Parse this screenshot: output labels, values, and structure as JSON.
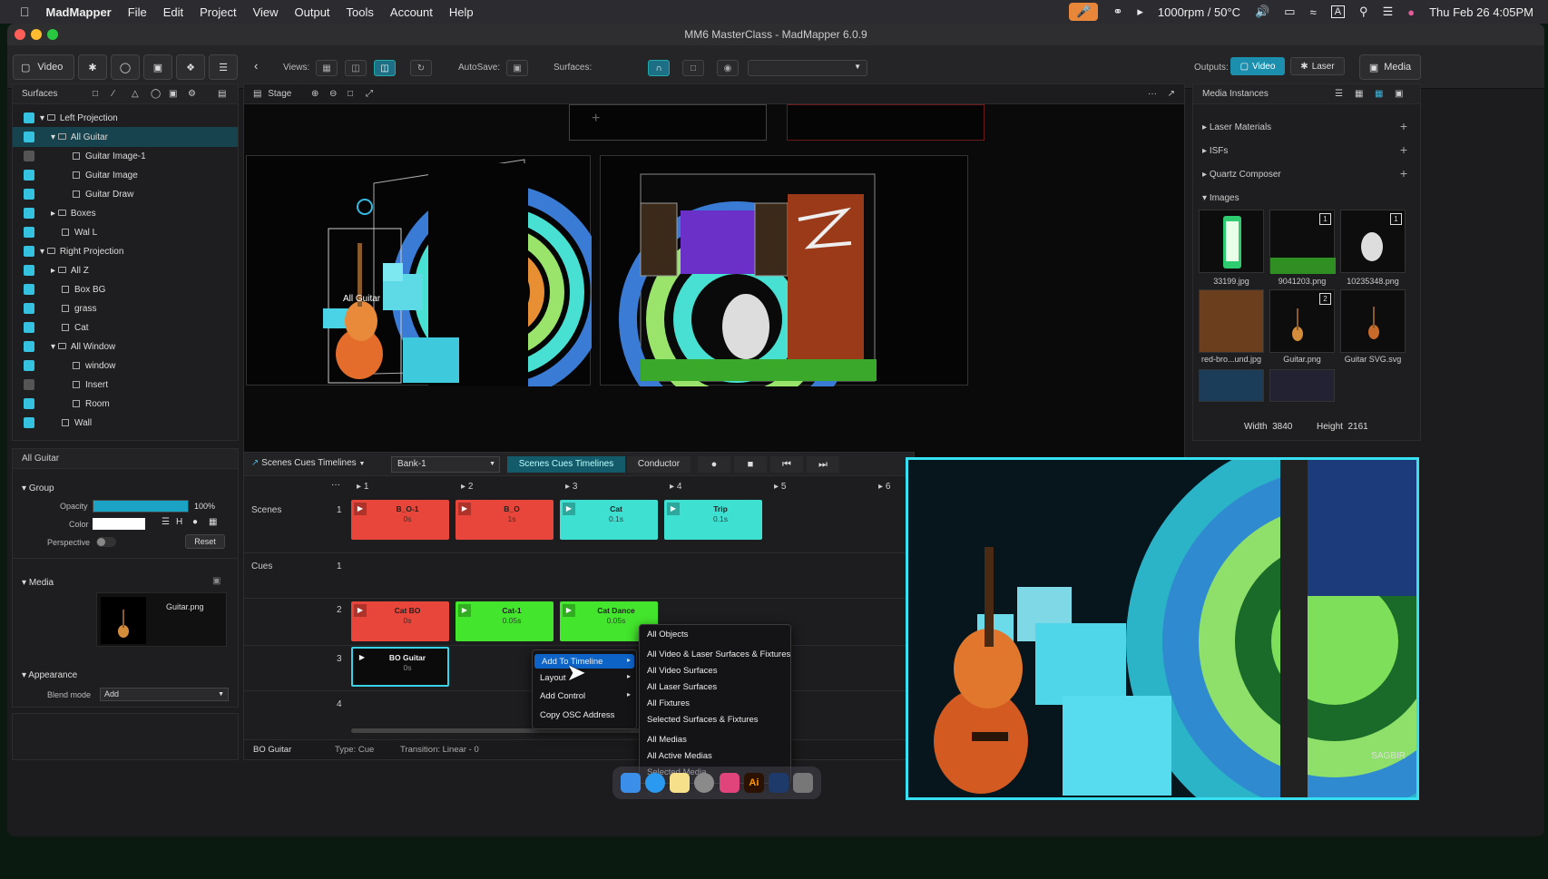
{
  "menubar": {
    "app": "MadMapper",
    "items": [
      "File",
      "Edit",
      "Project",
      "View",
      "Output",
      "Tools",
      "Account",
      "Help"
    ],
    "status": "1000rpm / 50°C",
    "clock": "Thu Feb 26  4:05PM"
  },
  "window": {
    "title": "MM6 MasterClass - MadMapper 6.0.9"
  },
  "toolbar": {
    "video_label": "Video",
    "views_label": "Views:",
    "autosave_label": "AutoSave:",
    "surfaces_label": "Surfaces:",
    "outputs_label": "Outputs:",
    "output_video": "Video",
    "output_laser": "Laser",
    "media_label": "Media"
  },
  "surfaces": {
    "title": "Surfaces",
    "items": [
      {
        "label": "Left Projection",
        "checked": true
      },
      {
        "label": "All Guitar",
        "checked": true
      },
      {
        "label": "Guitar Image-1",
        "checked": false
      },
      {
        "label": "Guitar Image",
        "checked": true
      },
      {
        "label": "Guitar Draw",
        "checked": true
      },
      {
        "label": "Boxes",
        "checked": true
      },
      {
        "label": "Wal L",
        "checked": true
      },
      {
        "label": "Right Projection",
        "checked": true
      },
      {
        "label": "All Z",
        "checked": true
      },
      {
        "label": "Box BG",
        "checked": true
      },
      {
        "label": "grass",
        "checked": true
      },
      {
        "label": "Cat",
        "checked": true
      },
      {
        "label": "All Window",
        "checked": true
      },
      {
        "label": "window",
        "checked": true
      },
      {
        "label": "Insert",
        "checked": false
      },
      {
        "label": "Room",
        "checked": true
      },
      {
        "label": "Wall",
        "checked": true
      }
    ]
  },
  "inspector": {
    "title": "All Guitar",
    "group_label": "Group",
    "opacity_label": "Opacity",
    "opacity_value": "100%",
    "opacity": 1.0,
    "color_label": "Color",
    "perspective_label": "Perspective",
    "reset_label": "Reset",
    "media_label": "Media",
    "media_file": "Guitar.png",
    "appearance_label": "Appearance",
    "blend_label": "Blend mode",
    "blend_value": "Add"
  },
  "stage": {
    "tab": "Stage",
    "overlay_label": "All Guitar"
  },
  "media_instances": {
    "title": "Media Instances",
    "sections": [
      "Laser Materials",
      "ISFs",
      "Quartz Composer",
      "Images"
    ],
    "images": [
      {
        "name": "33199.jpg",
        "badge": ""
      },
      {
        "name": "9041203.png",
        "badge": "1"
      },
      {
        "name": "10235348.png",
        "badge": "1"
      },
      {
        "name": "red-bro...und.jpg",
        "badge": ""
      },
      {
        "name": "Guitar.png",
        "badge": "2"
      },
      {
        "name": "Guitar SVG.svg",
        "badge": ""
      }
    ],
    "width_label": "Width",
    "width_value": "3840",
    "height_label": "Height",
    "height_value": "2161"
  },
  "timeline": {
    "mode_label": "Scenes Cues Timelines",
    "bank": "Bank-1",
    "tab_active": "Scenes Cues Timelines",
    "tab_conductor": "Conductor",
    "columns": [
      "1",
      "2",
      "3",
      "4",
      "5",
      "6"
    ],
    "scenes_label": "Scenes",
    "cues_label": "Cues",
    "row_numbers": [
      "1",
      "1",
      "2",
      "3",
      "4"
    ],
    "scenes": [
      {
        "name": "B_O-1",
        "time": "0s",
        "color": "#e8463a"
      },
      {
        "name": "B_O",
        "time": "1s",
        "color": "#e8463a"
      },
      {
        "name": "Cat",
        "time": "0.1s",
        "color": "#3ee0d2"
      },
      {
        "name": "Trip",
        "time": "0.1s",
        "color": "#3ee0d2"
      }
    ],
    "cues": [
      {
        "name": "Cat BO",
        "time": "0s",
        "color": "#e8463a"
      },
      {
        "name": "Cat-1",
        "time": "0.05s",
        "color": "#43e62c"
      },
      {
        "name": "Cat Dance",
        "time": "0.05s",
        "color": "#43e62c"
      }
    ],
    "selected_cue": {
      "name": "BO Guitar",
      "time": "0s"
    },
    "footer_name": "BO Guitar",
    "footer_type": "Type:  Cue",
    "footer_transition": "Transition:   Linear - 0"
  },
  "context_menu": {
    "items": [
      "Add To Timeline",
      "Layout",
      "Add Control",
      "Copy OSC Address"
    ]
  },
  "submenu": {
    "items": [
      "All Objects",
      "All Video & Laser Surfaces & Fixtures",
      "All Video Surfaces",
      "All Laser Surfaces",
      "All Fixtures",
      "Selected Surfaces & Fixtures",
      "All Medias",
      "All Active Medias",
      "Selected Media"
    ]
  },
  "preview": {
    "watermark": "SAGBIR"
  }
}
